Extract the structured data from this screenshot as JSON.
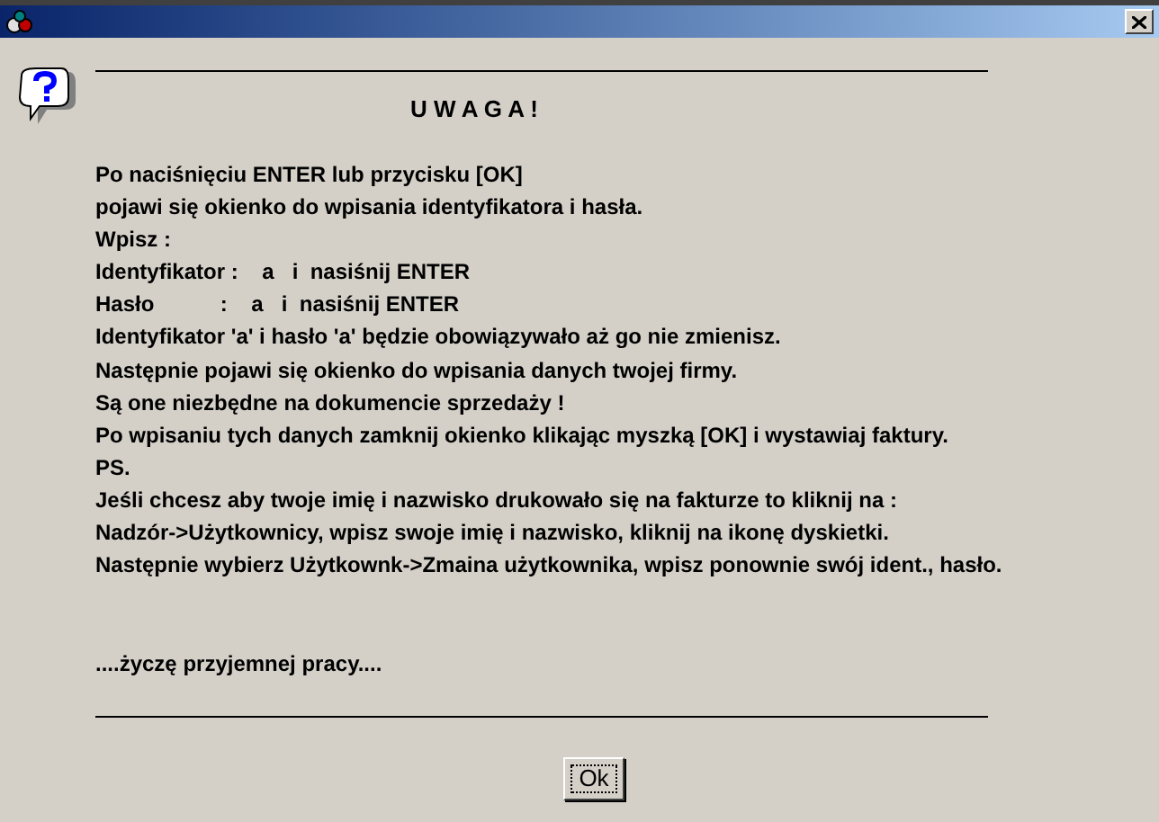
{
  "heading": "U W A G A !",
  "message_lines": [
    "Po naciśnięciu ENTER lub przycisku [OK]",
    "pojawi się okienko do wpisania identyfikatora i hasła.",
    "Wpisz :",
    "Identyfikator :    a   i  nasiśnij ENTER",
    "Hasło           :    a   i  nasiśnij ENTER",
    "Identyfikator 'a' i hasło 'a' będzie obowiązywało aż go nie zmienisz.",
    "Następnie pojawi się okienko do wpisania danych twojej firmy.",
    "Są one niezbędne na dokumencie sprzedaży !",
    "Po wpisaniu tych danych zamknij okienko klikając myszką [OK] i wystawiaj faktury.",
    "PS.",
    "Jeśli chcesz aby twoje imię i nazwisko drukowało się na fakturze to kliknij na :",
    "Nadzór->Użytkownicy, wpisz swoje imię i nazwisko, kliknij na ikonę dyskietki.",
    "Następnie wybierz Użytkownk->Zmaina użytkownika, wpisz ponownie swój ident., hasło."
  ],
  "closing": "....życzę przyjemnej pracy....",
  "ok_button": "Ok"
}
